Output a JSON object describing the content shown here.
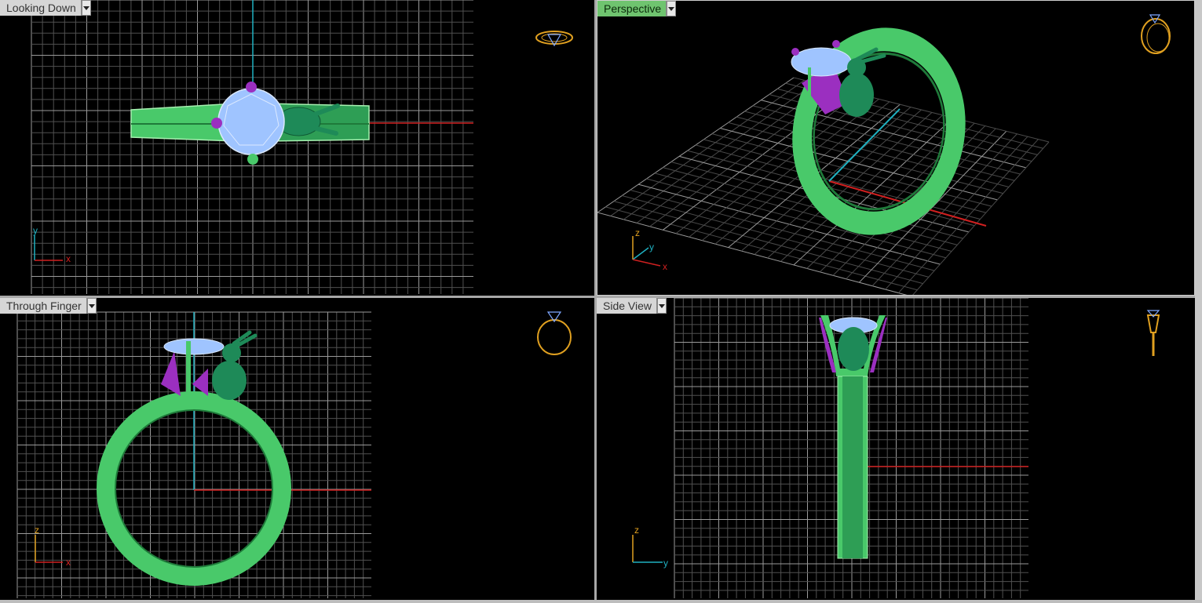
{
  "viewports": {
    "top": {
      "label": "Looking Down"
    },
    "perspective": {
      "label": "Perspective"
    },
    "front": {
      "label": "Through Finger"
    },
    "side": {
      "label": "Side View"
    }
  },
  "axes": {
    "top": {
      "a": "y",
      "b": "x"
    },
    "perspective": {
      "a": "z",
      "b": "y",
      "c": "x"
    },
    "front": {
      "a": "z",
      "b": "x"
    },
    "side": {
      "a": "z",
      "b": "y"
    }
  },
  "colors": {
    "background": "#000000",
    "grid": "#8a8a8a",
    "ring": "#49c96a",
    "ring_dark": "#1f7a3a",
    "gem": "#9fc4ff",
    "prong": "#9b2fc0",
    "bunny": "#1e8a58",
    "axis_x": "#d02020",
    "axis_y": "#1fb0c0",
    "axis_z": "#e0a020",
    "gizmo": "#e0a020",
    "active_tab": "#6fc46f"
  },
  "icons": {
    "top": "ring-top-gizmo-icon",
    "perspective": "ring-perspective-gizmo-icon",
    "front": "ring-front-gizmo-icon",
    "side": "ring-side-gizmo-icon"
  }
}
